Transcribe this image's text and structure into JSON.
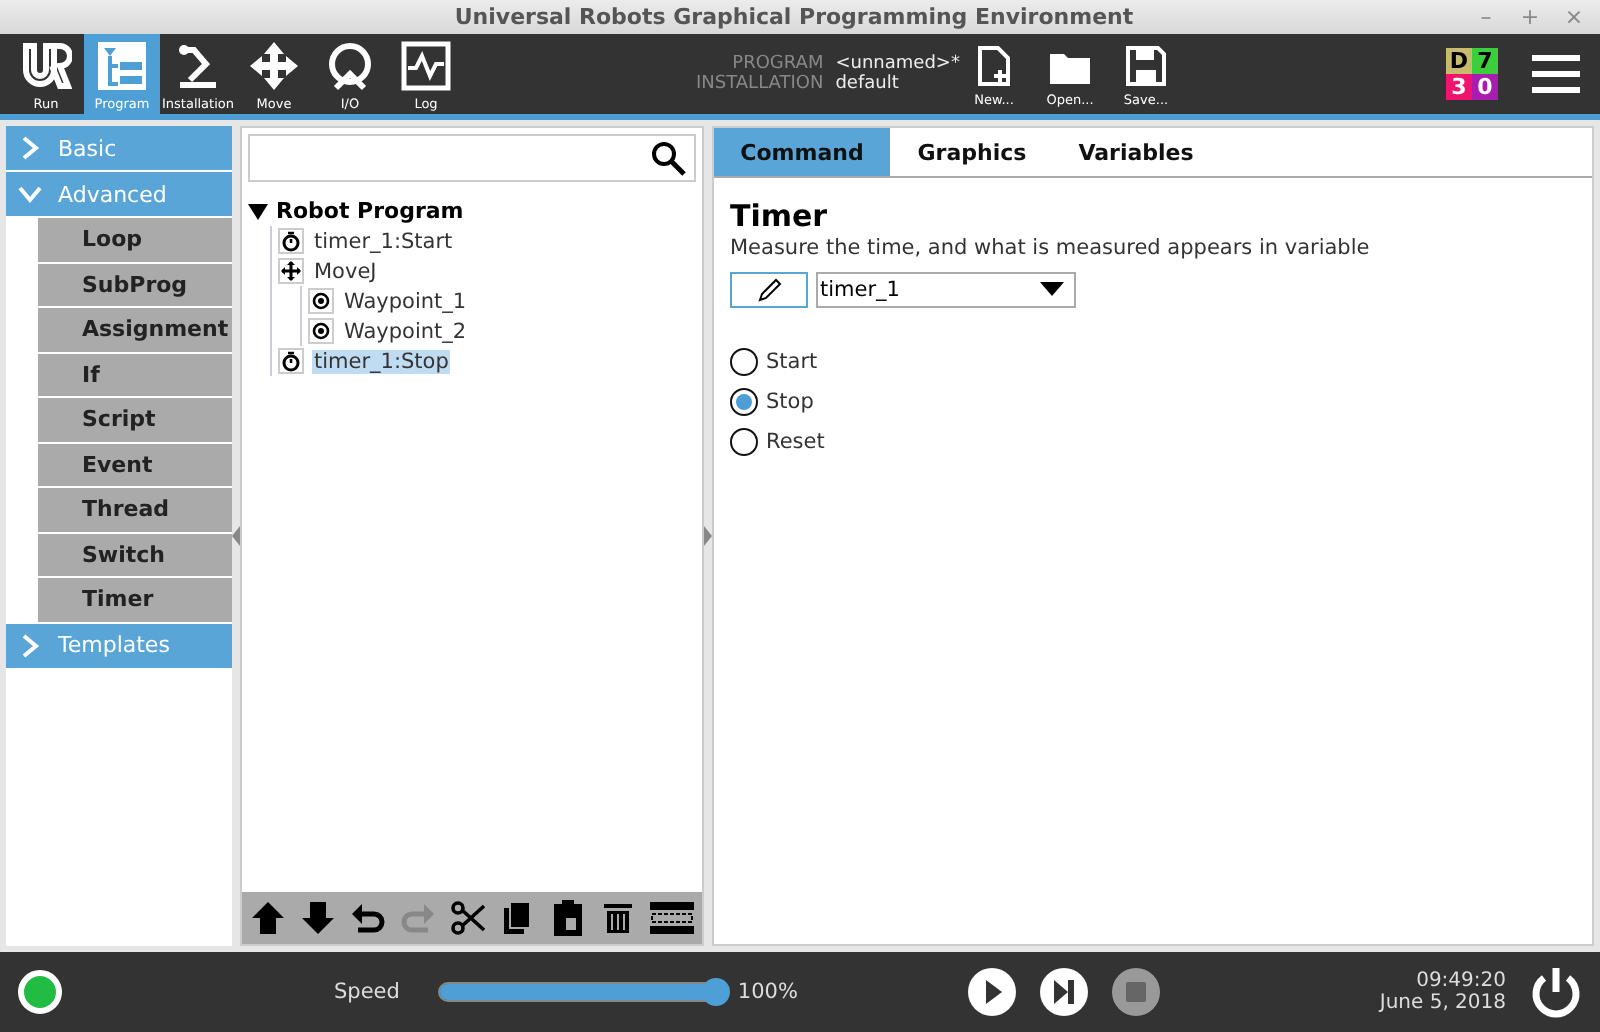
{
  "window": {
    "title": "Universal Robots Graphical Programming Environment",
    "controls": [
      "–",
      "+",
      "×"
    ]
  },
  "toolbar": {
    "nav": [
      {
        "label": "Run",
        "kind": "logo",
        "selected": false
      },
      {
        "label": "Program",
        "kind": "program",
        "selected": true
      },
      {
        "label": "Installation",
        "kind": "arm",
        "selected": false
      },
      {
        "label": "Move",
        "kind": "move",
        "selected": false
      },
      {
        "label": "I/O",
        "kind": "io",
        "selected": false
      },
      {
        "label": "Log",
        "kind": "log",
        "selected": false
      }
    ],
    "program_label": "PROGRAM",
    "program_value": "<unnamed>*",
    "installation_label": "INSTALLATION",
    "installation_value": "default",
    "file_buttons": [
      {
        "label": "New...",
        "kind": "new"
      },
      {
        "label": "Open...",
        "kind": "open"
      },
      {
        "label": "Save...",
        "kind": "save"
      }
    ],
    "status_grid": [
      {
        "text": "D",
        "color": "#c9bb6e"
      },
      {
        "text": "7",
        "color": "#3ccf3c"
      },
      {
        "text": "3",
        "color": "#f0146e"
      },
      {
        "text": "0",
        "color": "#a81cb0"
      }
    ]
  },
  "sidebar": [
    {
      "label": "Basic",
      "expanded": false
    },
    {
      "label": "Advanced",
      "expanded": true,
      "items": [
        "Loop",
        "SubProg",
        "Assignment",
        "If",
        "Script",
        "Event",
        "Thread",
        "Switch",
        "Timer"
      ]
    },
    {
      "label": "Templates",
      "expanded": false
    }
  ],
  "tree": {
    "label": "Robot Program",
    "expanded": true,
    "children": [
      {
        "label": "timer_1:Start",
        "kind": "timer",
        "selected": false
      },
      {
        "label": "MoveJ",
        "kind": "move",
        "selected": false,
        "children": [
          {
            "label": "Waypoint_1",
            "kind": "waypoint",
            "selected": false
          },
          {
            "label": "Waypoint_2",
            "kind": "waypoint",
            "selected": false
          }
        ]
      },
      {
        "label": "timer_1:Stop",
        "kind": "timer",
        "selected": true
      }
    ]
  },
  "tree_toolbar": [
    {
      "kind": "up",
      "disabled": false
    },
    {
      "kind": "down",
      "disabled": false
    },
    {
      "kind": "undo",
      "disabled": false
    },
    {
      "kind": "redo",
      "disabled": true
    },
    {
      "kind": "cut",
      "disabled": false
    },
    {
      "kind": "copy",
      "disabled": false
    },
    {
      "kind": "paste",
      "disabled": false
    },
    {
      "kind": "delete",
      "disabled": false
    },
    {
      "kind": "suppress",
      "disabled": false
    }
  ],
  "tabs": [
    {
      "label": "Command",
      "selected": true
    },
    {
      "label": "Graphics",
      "selected": false
    },
    {
      "label": "Variables",
      "selected": false
    }
  ],
  "command": {
    "title": "Timer",
    "description": "Measure the time, and what is measured appears in variable",
    "variable": "timer_1",
    "options": [
      {
        "label": "Start",
        "selected": false
      },
      {
        "label": "Stop",
        "selected": true
      },
      {
        "label": "Reset",
        "selected": false
      }
    ]
  },
  "footer": {
    "running": true,
    "speed_label": "Speed",
    "level": 1.0,
    "reading": "100%",
    "controls": [
      {
        "kind": "play",
        "disabled": false
      },
      {
        "kind": "step",
        "disabled": false
      },
      {
        "kind": "stop",
        "disabled": true
      }
    ],
    "time": "09:49:20",
    "date": "June 5, 2018"
  }
}
